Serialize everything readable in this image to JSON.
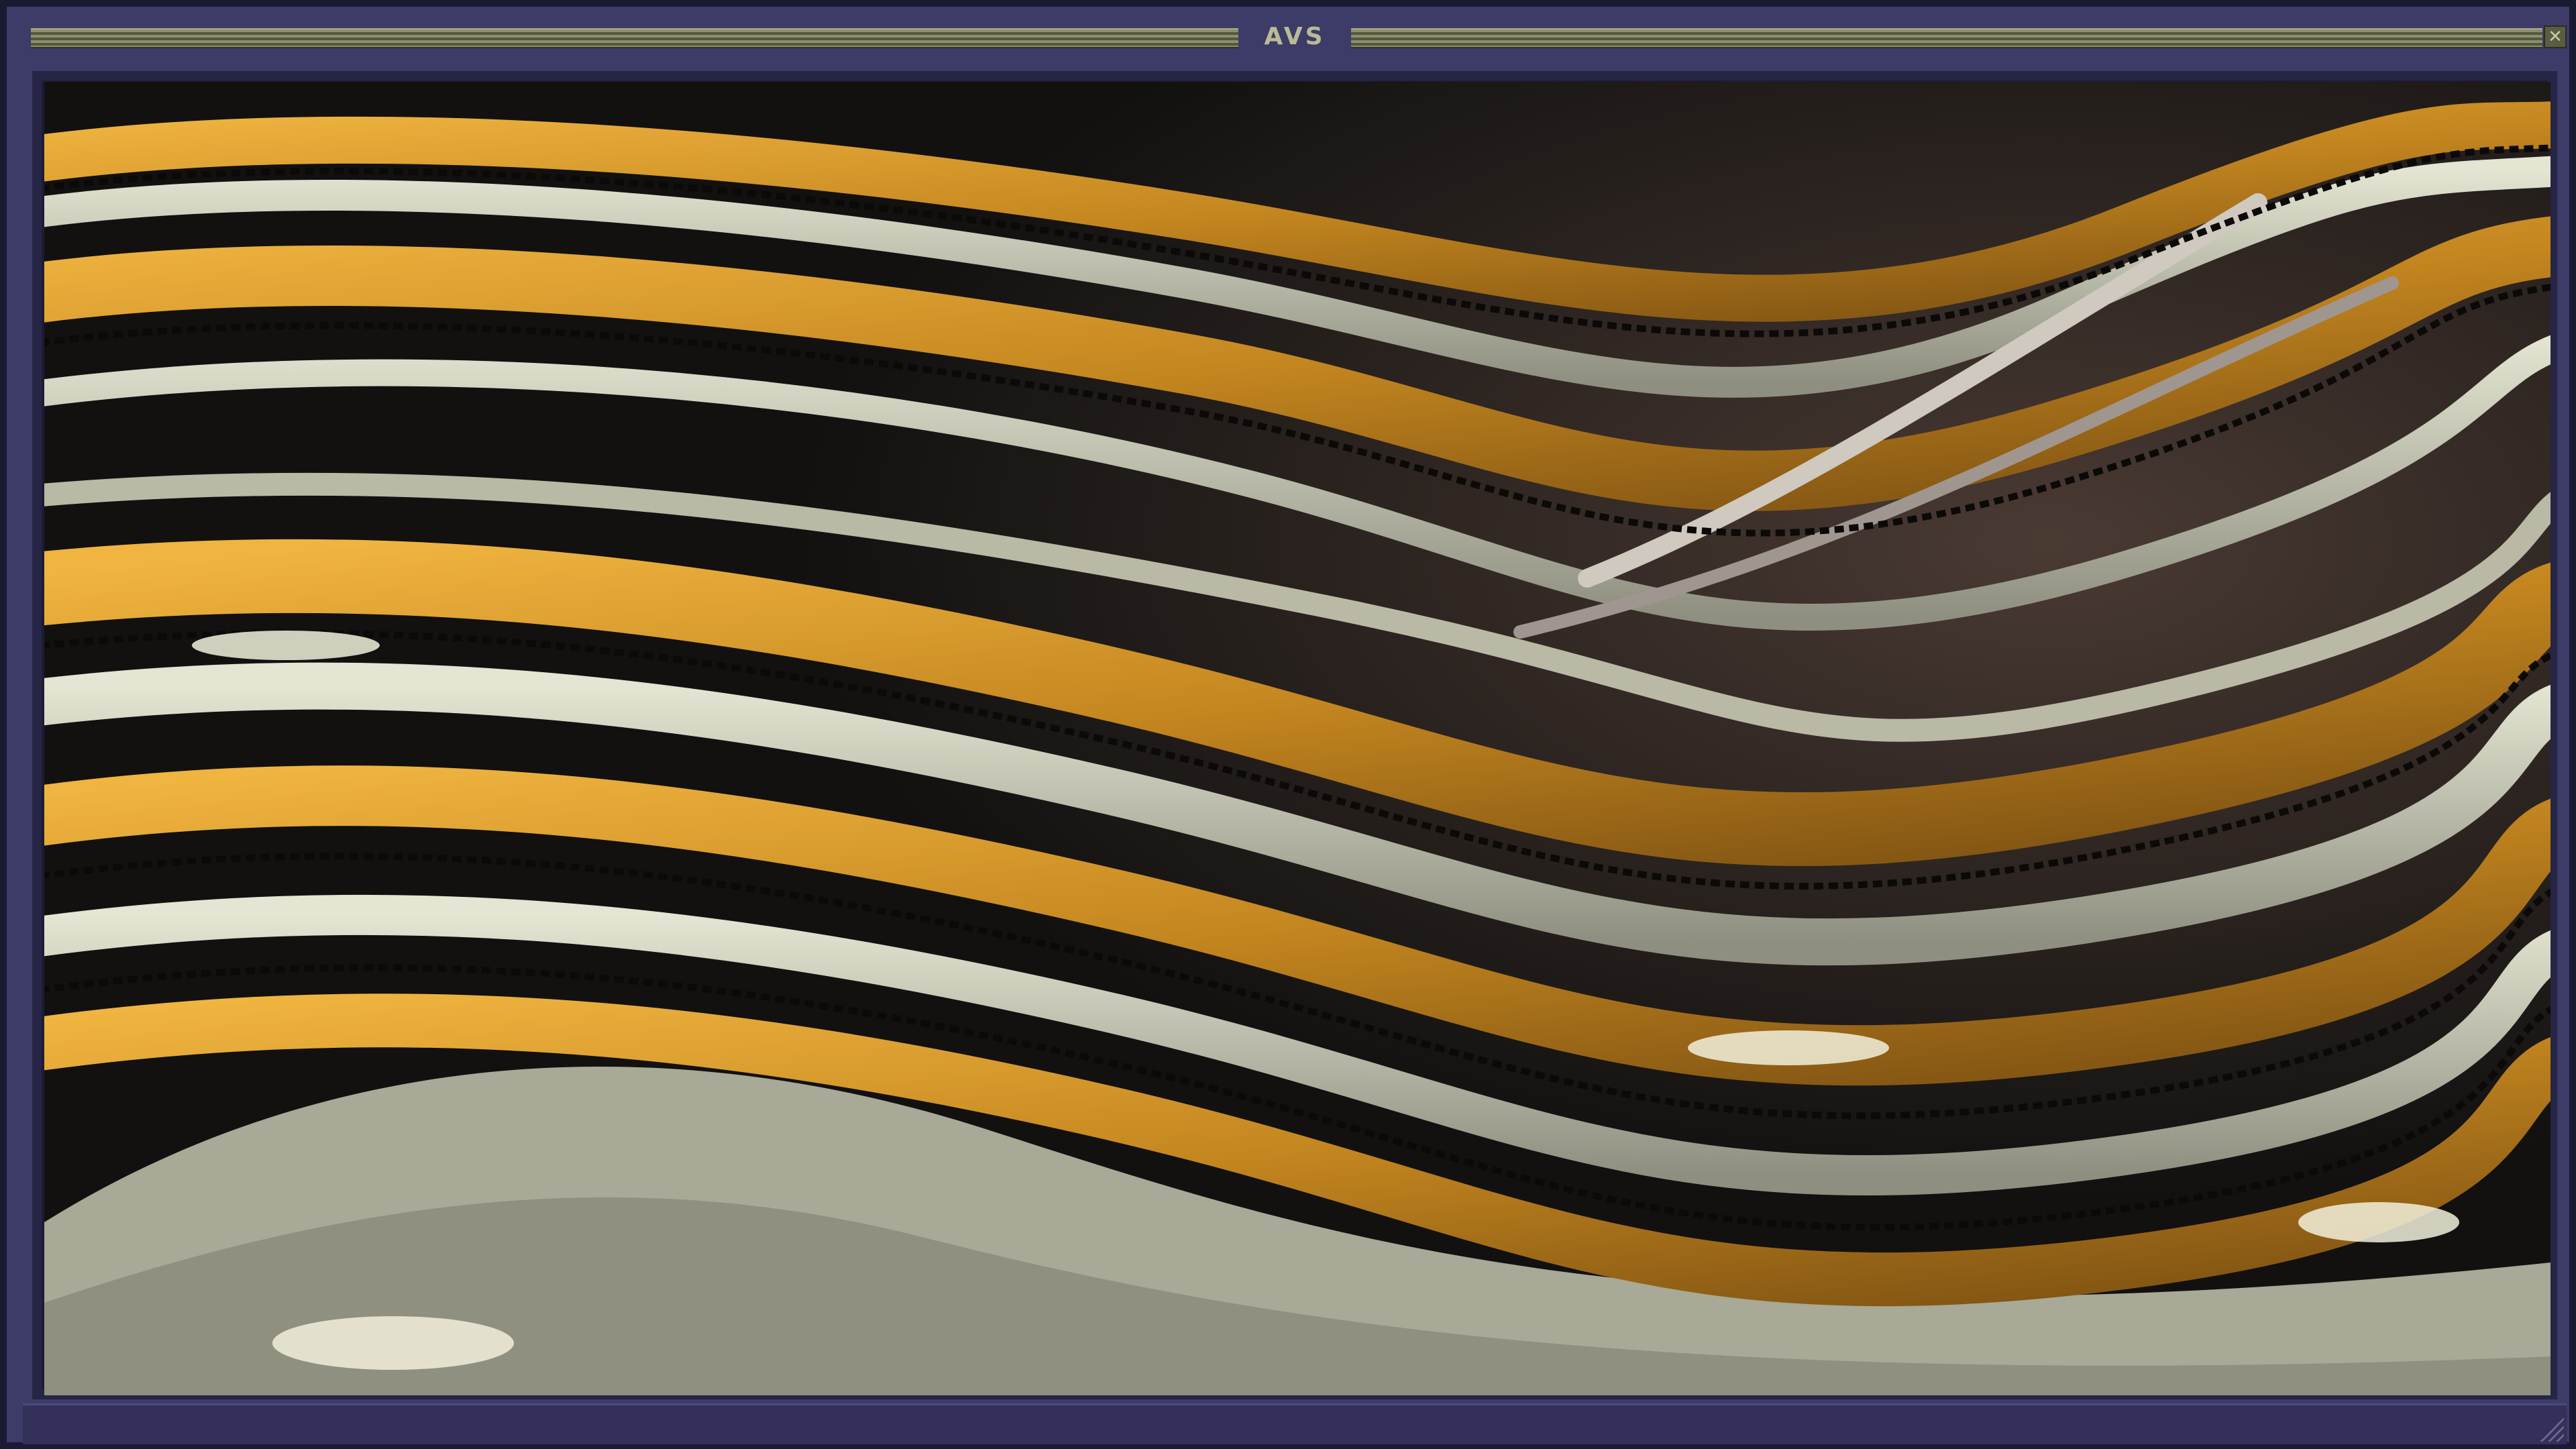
{
  "window": {
    "title": "AVS"
  },
  "colors": {
    "frame": "#3d3b68",
    "titlebar_grip": "#8c8f6c",
    "gold": "#d79a2c",
    "silver": "#b8b9a8",
    "dark": "#151411"
  },
  "icons": {
    "close": "close-icon",
    "resize": "resize-grip-icon"
  }
}
